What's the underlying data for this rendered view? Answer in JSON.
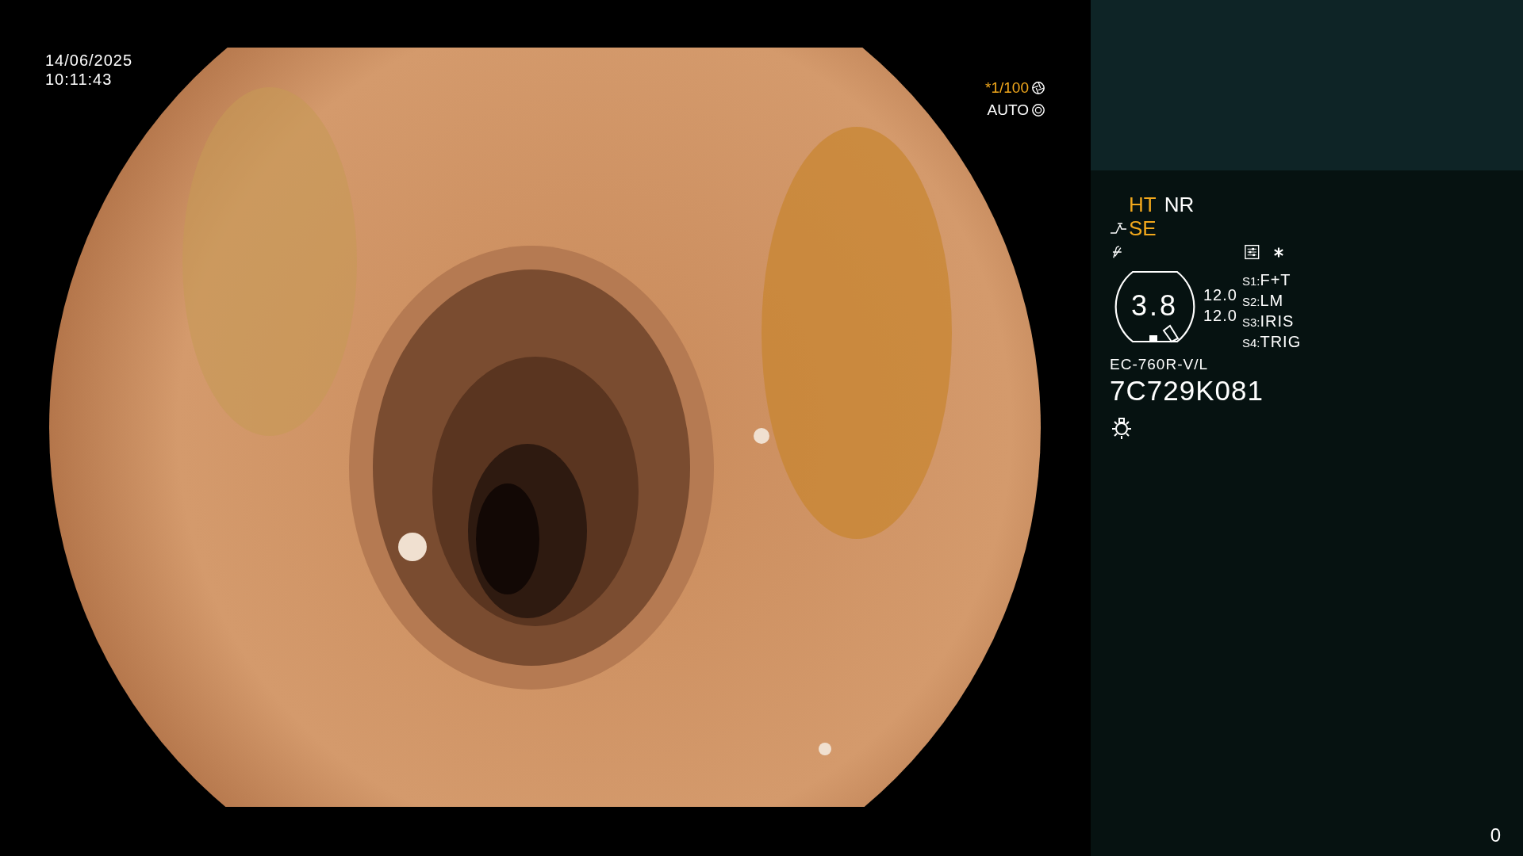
{
  "timestamp": {
    "date": "14/06/2025",
    "time": "10:11:43"
  },
  "shutter": {
    "speed": "*1/100",
    "speed_active": true,
    "mode": "AUTO",
    "mode_active": false
  },
  "panel": {
    "indicators": [
      {
        "label": "HT",
        "active": true
      },
      {
        "label": "NR",
        "active": false
      }
    ],
    "structure": {
      "label": "SE",
      "active": true
    },
    "scope": {
      "value": "3.8",
      "readings": [
        "12.0",
        "12.0"
      ]
    },
    "switches": [
      {
        "key": "S1:",
        "value": "F+T"
      },
      {
        "key": "S2:",
        "value": "LM"
      },
      {
        "key": "S3:",
        "value": "IRIS"
      },
      {
        "key": "S4:",
        "value": "TRIG"
      }
    ],
    "model": "EC-760R-V/L",
    "serial": "7C729K081",
    "counter": "0"
  }
}
